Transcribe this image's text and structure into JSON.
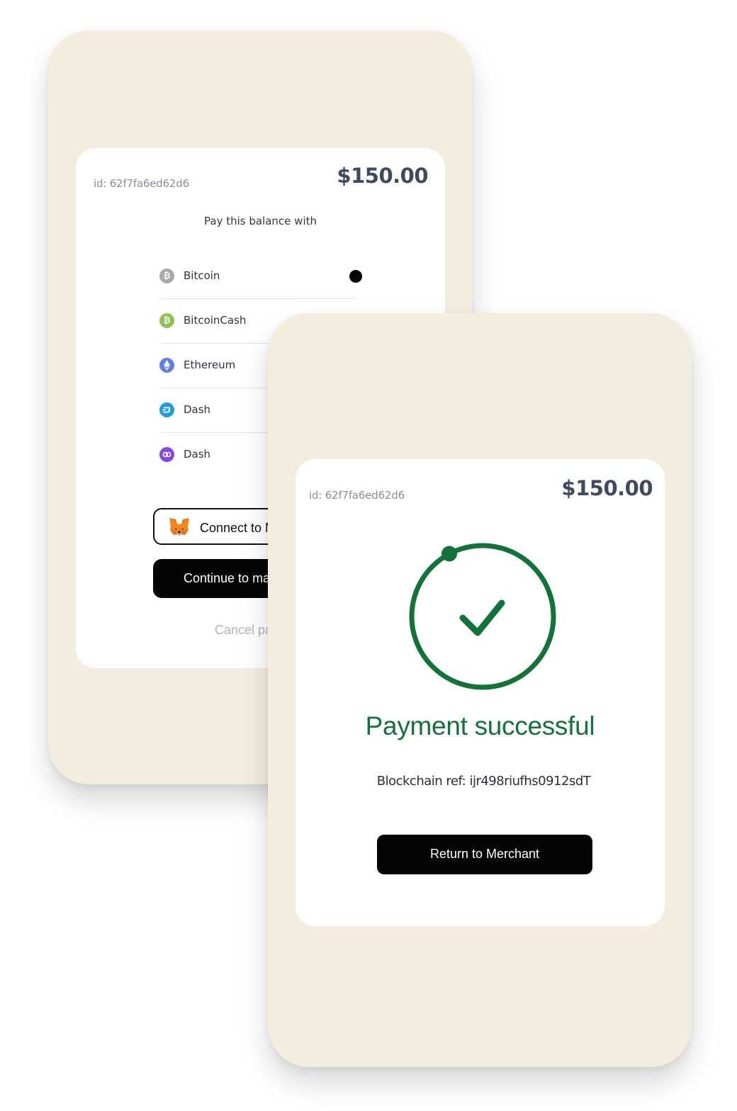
{
  "colors": {
    "phone_bg": "#f3ede0",
    "card_bg": "#ffffff",
    "success_green": "#13713a",
    "primary_button": "#050505",
    "amount_text": "#3f4a5f"
  },
  "checkout": {
    "order_id": "id: 62f7fa6ed62d6",
    "amount": "$150.00",
    "pay_with_label": "Pay this balance with",
    "currencies": [
      {
        "label": "Bitcoin",
        "icon": "bitcoin-icon",
        "color": "#a9a9a9",
        "selected": true
      },
      {
        "label": "BitcoinCash",
        "icon": "bitcoin-cash-icon",
        "color": "#8dc351",
        "selected": false
      },
      {
        "label": "Ethereum",
        "icon": "ethereum-icon",
        "color": "#627eea",
        "selected": false
      },
      {
        "label": "Dash",
        "icon": "dash-icon",
        "color": "#1c9ee0",
        "selected": false
      },
      {
        "label": "Dash",
        "icon": "polygon-icon",
        "color": "#8247e5",
        "selected": false
      }
    ],
    "connect_wallet_label": "Connect to M",
    "continue_label": "Continue to ma",
    "cancel_label": "Cancel pa"
  },
  "success": {
    "order_id": "id: 62f7fa6ed62d6",
    "amount": "$150.00",
    "title": "Payment successful",
    "blockchain_ref": "Blockchain ref: ijr498riufhs0912sdT",
    "return_label": "Return to Merchant"
  }
}
